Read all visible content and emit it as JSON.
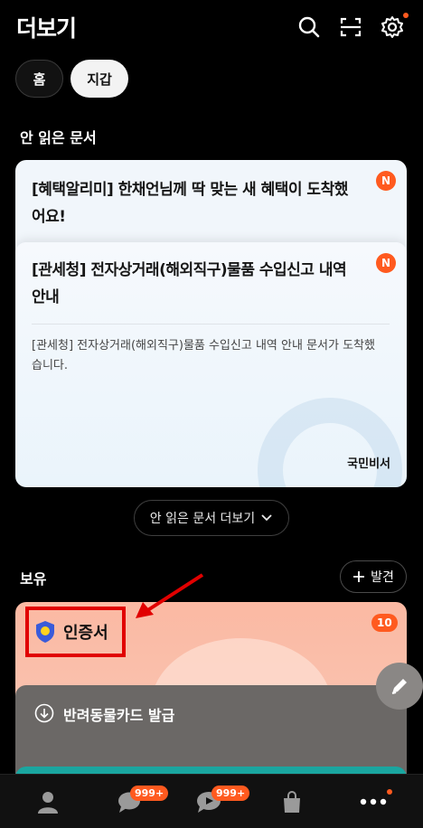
{
  "header": {
    "title": "더보기",
    "icons": [
      "search-icon",
      "scan-icon",
      "settings-icon"
    ]
  },
  "tabs": [
    {
      "label": "홈",
      "selected": false
    },
    {
      "label": "지갑",
      "selected": true
    }
  ],
  "unread": {
    "section_title": "안 읽은 문서",
    "back_card": {
      "title": "[혜택알리미] 한채언님께 딱 맞는 새 혜택이 도착했어요!",
      "badge": "N"
    },
    "front_card": {
      "title": "[관세청] 전자상거래(해외직구)물품 수입신고 내역 안내",
      "badge": "N",
      "body": "[관세청] 전자상거래(해외직구)물품 수입신고 내역 안내 문서가 도착했습니다.",
      "footer": "국민비서"
    },
    "more_button": "안 읽은 문서 더보기"
  },
  "holdings": {
    "section_title": "보유",
    "discover_button": "발견",
    "cert_card": {
      "label": "인증서",
      "count": "10"
    },
    "pet_card": {
      "label": "반려동물카드 발급"
    }
  },
  "bottom_nav": {
    "chat_badge": "999+",
    "video_badge": "999+"
  },
  "colors": {
    "accent": "#ff5a1f",
    "highlight": "#e10000",
    "cert_bg": "#fbb9a3"
  }
}
